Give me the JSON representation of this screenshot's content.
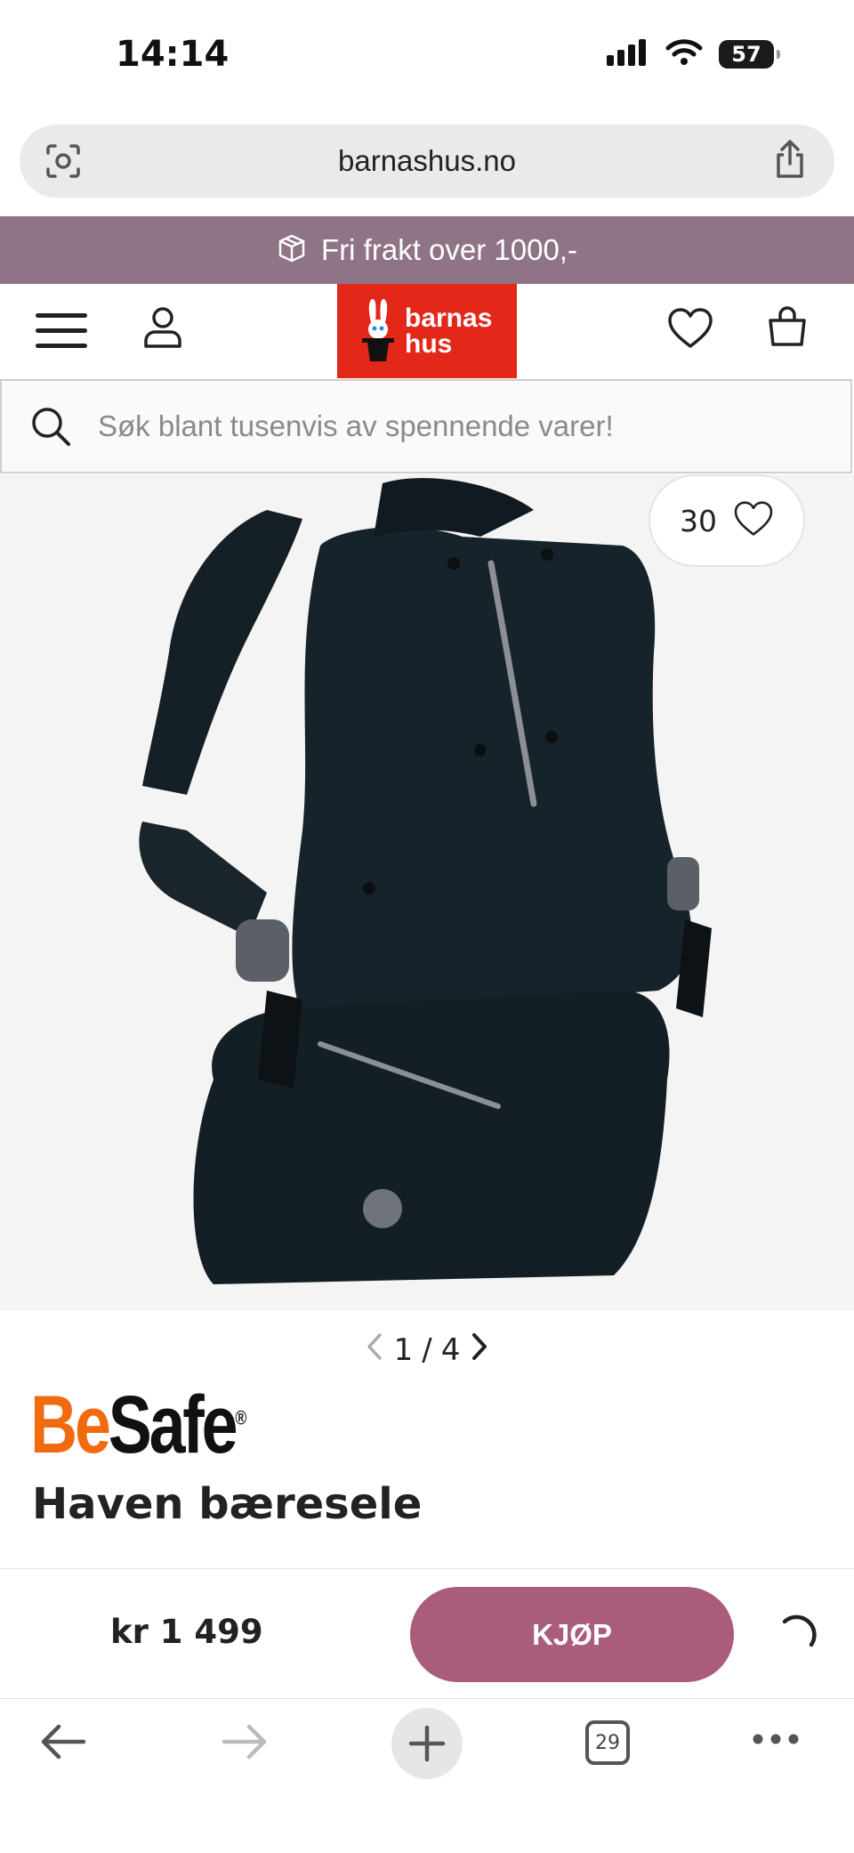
{
  "status_bar": {
    "time": "14:14",
    "battery": "57"
  },
  "browser": {
    "url": "barnashus.no",
    "open_tabs": "29"
  },
  "promo": {
    "text": "Fri frakt over 1000,-"
  },
  "logo": {
    "line1": "barnas",
    "line2": "hus"
  },
  "search": {
    "placeholder": "Søk blant tusenvis av spennende varer!"
  },
  "product": {
    "favorites_count": "30",
    "pager_current": "1",
    "pager_separator": "/",
    "pager_total": "4",
    "brand_part1": "Be",
    "brand_part2": "Safe",
    "brand_mark": "®",
    "title": "Haven bæresele",
    "price": "kr 1 499",
    "buy_label": "KJØP"
  },
  "colors": {
    "promo_bg": "#8f7386",
    "buy_button": "#a95c7c",
    "logo_bg": "#e32719",
    "brand_orange": "#f26a10"
  }
}
